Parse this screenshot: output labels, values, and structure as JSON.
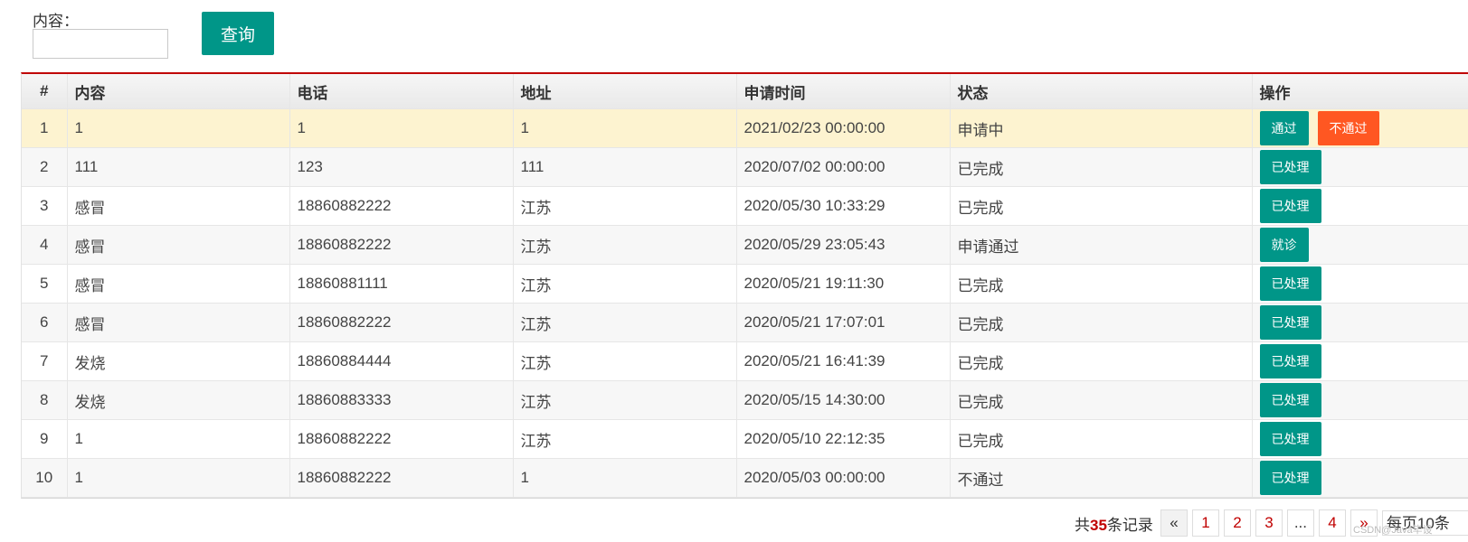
{
  "search": {
    "label": "内容：",
    "value": "",
    "button": "查询"
  },
  "table": {
    "columns": [
      "#",
      "内容",
      "电话",
      "地址",
      "申请时间",
      "状态",
      "操作"
    ],
    "rows": [
      {
        "no": "1",
        "content": "1",
        "phone": "1",
        "address": "1",
        "time": "2021/02/23 00:00:00",
        "status": "申请中",
        "actions": [
          "通过",
          "不通过"
        ]
      },
      {
        "no": "2",
        "content": "111",
        "phone": "123",
        "address": "111",
        "time": "2020/07/02 00:00:00",
        "status": "已完成",
        "actions": [
          "已处理"
        ]
      },
      {
        "no": "3",
        "content": "感冒",
        "phone": "18860882222",
        "address": "江苏",
        "time": "2020/05/30 10:33:29",
        "status": "已完成",
        "actions": [
          "已处理"
        ]
      },
      {
        "no": "4",
        "content": "感冒",
        "phone": "18860882222",
        "address": "江苏",
        "time": "2020/05/29 23:05:43",
        "status": "申请通过",
        "actions": [
          "就诊"
        ]
      },
      {
        "no": "5",
        "content": "感冒",
        "phone": "18860881111",
        "address": "江苏",
        "time": "2020/05/21 19:11:30",
        "status": "已完成",
        "actions": [
          "已处理"
        ]
      },
      {
        "no": "6",
        "content": "感冒",
        "phone": "18860882222",
        "address": "江苏",
        "time": "2020/05/21 17:07:01",
        "status": "已完成",
        "actions": [
          "已处理"
        ]
      },
      {
        "no": "7",
        "content": "发烧",
        "phone": "18860884444",
        "address": "江苏",
        "time": "2020/05/21 16:41:39",
        "status": "已完成",
        "actions": [
          "已处理"
        ]
      },
      {
        "no": "8",
        "content": "发烧",
        "phone": "18860883333",
        "address": "江苏",
        "time": "2020/05/15 14:30:00",
        "status": "已完成",
        "actions": [
          "已处理"
        ]
      },
      {
        "no": "9",
        "content": "1",
        "phone": "18860882222",
        "address": "江苏",
        "time": "2020/05/10 22:12:35",
        "status": "已完成",
        "actions": [
          "已处理"
        ]
      },
      {
        "no": "10",
        "content": "1",
        "phone": "18860882222",
        "address": "1",
        "time": "2020/05/03 00:00:00",
        "status": "不通过",
        "actions": [
          "已处理"
        ]
      }
    ]
  },
  "pagination": {
    "total_prefix": "共",
    "total_count": "35",
    "total_suffix": "条记录",
    "prev": "«",
    "pages": [
      "1",
      "2",
      "3",
      "...",
      "4"
    ],
    "next": "»",
    "page_size": "每页10条"
  },
  "watermark": "CSDN@Java毕设"
}
